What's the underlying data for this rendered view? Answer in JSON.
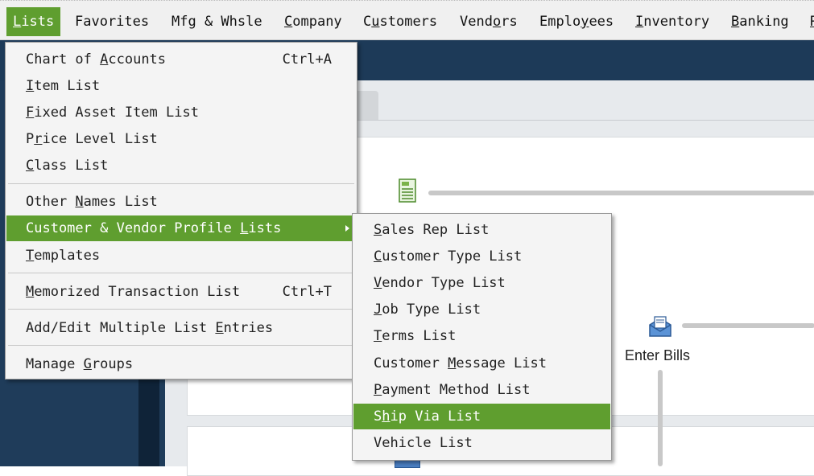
{
  "menubar": {
    "items": [
      {
        "pre": "",
        "u": "L",
        "post": "ists"
      },
      {
        "pre": "Favorites",
        "u": "",
        "post": ""
      },
      {
        "pre": "Mfg & Whsle",
        "u": "",
        "post": ""
      },
      {
        "pre": "",
        "u": "C",
        "post": "ompany"
      },
      {
        "pre": "C",
        "u": "u",
        "post": "stomers"
      },
      {
        "pre": "Vend",
        "u": "o",
        "post": "rs"
      },
      {
        "pre": "Emplo",
        "u": "y",
        "post": "ees"
      },
      {
        "pre": "",
        "u": "I",
        "post": "nventory"
      },
      {
        "pre": "",
        "u": "B",
        "post": "anking"
      },
      {
        "pre": "",
        "u": "R",
        "post": ""
      }
    ]
  },
  "lists_menu": {
    "items": [
      {
        "pre": "Chart of ",
        "u": "A",
        "post": "ccounts",
        "shortcut": "Ctrl+A"
      },
      {
        "pre": "",
        "u": "I",
        "post": "tem List",
        "shortcut": ""
      },
      {
        "pre": "",
        "u": "F",
        "post": "ixed Asset Item List",
        "shortcut": ""
      },
      {
        "pre": "P",
        "u": "r",
        "post": "ice Level List",
        "shortcut": ""
      },
      {
        "pre": "",
        "u": "C",
        "post": "lass List",
        "shortcut": ""
      },
      {
        "pre": "Other ",
        "u": "N",
        "post": "ames List",
        "shortcut": ""
      },
      {
        "pre": "Customer & Vendor Profile ",
        "u": "L",
        "post": "ists",
        "shortcut": ""
      },
      {
        "pre": "",
        "u": "T",
        "post": "emplates",
        "shortcut": ""
      },
      {
        "pre": "",
        "u": "M",
        "post": "emorized Transaction List",
        "shortcut": "Ctrl+T"
      },
      {
        "pre": "Add/Edit Multiple List ",
        "u": "E",
        "post": "ntries",
        "shortcut": ""
      },
      {
        "pre": "Manage ",
        "u": "G",
        "post": "roups",
        "shortcut": ""
      }
    ]
  },
  "profile_submenu": {
    "items": [
      {
        "pre": "",
        "u": "S",
        "post": "ales Rep List"
      },
      {
        "pre": "",
        "u": "C",
        "post": "ustomer Type List"
      },
      {
        "pre": "",
        "u": "V",
        "post": "endor Type List"
      },
      {
        "pre": "",
        "u": "J",
        "post": "ob Type List"
      },
      {
        "pre": "",
        "u": "T",
        "post": "erms List"
      },
      {
        "pre": "Customer ",
        "u": "M",
        "post": "essage List"
      },
      {
        "pre": "",
        "u": "P",
        "post": "ayment Method List"
      },
      {
        "pre": "S",
        "u": "h",
        "post": "ip Via List"
      },
      {
        "pre": "Vehicle List",
        "u": "",
        "post": ""
      }
    ]
  },
  "workflow": {
    "enter_bills_label": "Enter Bills"
  },
  "colors": {
    "highlight": "#5f9e2f",
    "header_navy": "#1d3a58"
  },
  "icons": {
    "purchase_order": "purchase-order-icon",
    "enter_bills": "enter-bills-icon",
    "submenu_arrow": "chevron-right-icon"
  }
}
